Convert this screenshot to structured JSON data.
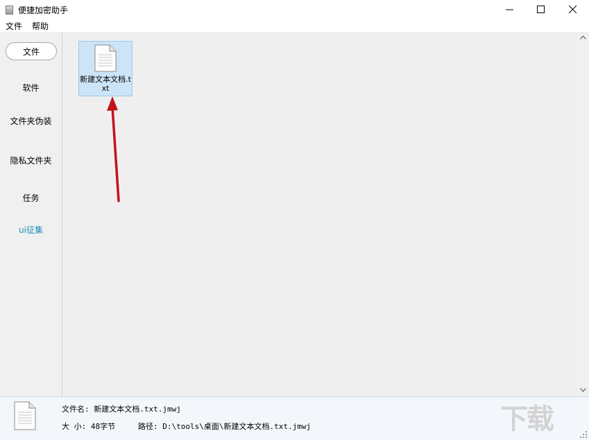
{
  "window": {
    "title": "便捷加密助手",
    "controls": [
      "minimize",
      "maximize",
      "close"
    ]
  },
  "menu": {
    "items": [
      "文件",
      "帮助"
    ]
  },
  "sidebar": {
    "items": [
      {
        "label": "文件",
        "selected": true
      },
      {
        "label": "软件"
      },
      {
        "label": "文件夹伪装"
      },
      {
        "label": "隐私文件夹"
      },
      {
        "label": "任务"
      },
      {
        "label": "ui征集",
        "color": "#1a8fb3"
      }
    ]
  },
  "files": [
    {
      "name": "新建文本文档.txt",
      "icon": "text-file-icon",
      "selected": true
    }
  ],
  "status": {
    "file_name_line": "文件名: 新建文本文档.txt.jmwj",
    "size_line": "大  小: 48字节",
    "path_line": "路径: D:\\tools\\桌面\\新建文本文档.txt.jmwj"
  },
  "watermark": "下载",
  "colors": {
    "selection_bg": "#cce4f7",
    "selection_border": "#99c9ef",
    "arrow": "#c0141b",
    "accent_link": "#1a8fb3"
  }
}
